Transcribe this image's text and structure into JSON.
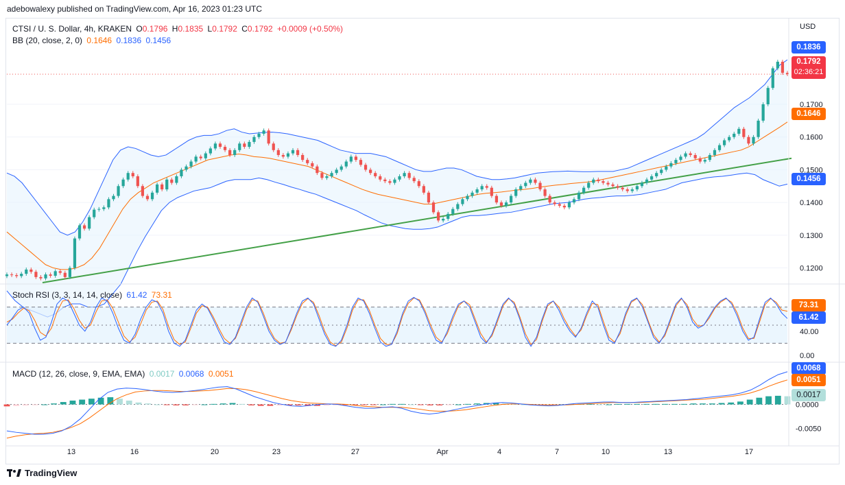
{
  "header": {
    "publish_line": "adebowalexy published on TradingView.com, Apr 16, 2023 01:23 UTC"
  },
  "main_legend": {
    "symbol": "CTSI / U. S. Dollar, 4h, KRAKEN",
    "o_label": "O",
    "o": "0.1796",
    "h_label": "H",
    "h": "0.1835",
    "l_label": "L",
    "l": "0.1792",
    "c_label": "C",
    "c": "0.1792",
    "change": "+0.0009 (+0.50%)",
    "bb_label": "BB (20, close, 2, 0)",
    "bb_basis": "0.1646",
    "bb_upper": "0.1836",
    "bb_lower": "0.1456"
  },
  "stoch_legend": {
    "label": "Stoch RSI (3, 3, 14, 14, close)",
    "k": "61.42",
    "d": "73.31"
  },
  "macd_legend": {
    "label": "MACD (12, 26, close, 9, EMA, EMA)",
    "hist": "0.0017",
    "macd": "0.0068",
    "signal": "0.0051"
  },
  "price_axis": {
    "currency": "USD",
    "ticks": [
      "0.1700",
      "0.1600",
      "0.1500",
      "0.1400",
      "0.1300",
      "0.1200"
    ],
    "last_price": "0.1792",
    "countdown": "02:36:21",
    "bb_upper_tag": "0.1836",
    "bb_basis_tag": "0.1646",
    "bb_lower_tag": "0.1456"
  },
  "stoch_axis": {
    "ticks": [
      "40.00",
      "0.00"
    ],
    "d_tag": "73.31",
    "k_tag": "61.42"
  },
  "macd_axis": {
    "ticks": [
      "0.0000",
      "-0.0050"
    ],
    "macd_tag": "0.0068",
    "signal_tag": "0.0051",
    "hist_tag": "0.0017"
  },
  "time_axis": {
    "ticks": [
      "13",
      "16",
      "20",
      "23",
      "27",
      "Apr",
      "4",
      "7",
      "10",
      "13",
      "17"
    ]
  },
  "footer": {
    "brand": "TradingView"
  },
  "colors": {
    "up": "#26a69a",
    "down": "#ef5350",
    "bb_band": "#2962ff",
    "bb_basis": "#ff6d00",
    "trendline": "#43a047",
    "k_line": "#2962ff",
    "d_line": "#ff6d00"
  },
  "chart_data": {
    "type": "line",
    "title": "CTSI / U. S. Dollar, 4h, KRAKEN",
    "close": [
      0.118,
      0.1178,
      0.1175,
      0.1182,
      0.1195,
      0.1188,
      0.1172,
      0.1168,
      0.118,
      0.1176,
      0.119,
      0.1185,
      0.1172,
      0.12,
      0.129,
      0.133,
      0.132,
      0.1355,
      0.1378,
      0.138,
      0.1385,
      0.141,
      0.142,
      0.145,
      0.147,
      0.149,
      0.148,
      0.145,
      0.142,
      0.141,
      0.143,
      0.1455,
      0.144,
      0.147,
      0.146,
      0.148,
      0.15,
      0.151,
      0.1525,
      0.154,
      0.1535,
      0.155,
      0.1565,
      0.158,
      0.157,
      0.156,
      0.1545,
      0.156,
      0.158,
      0.157,
      0.1585,
      0.16,
      0.161,
      0.162,
      0.158,
      0.156,
      0.1545,
      0.154,
      0.155,
      0.156,
      0.1545,
      0.153,
      0.152,
      0.151,
      0.149,
      0.1475,
      0.148,
      0.149,
      0.15,
      0.151,
      0.1525,
      0.154,
      0.153,
      0.1515,
      0.15,
      0.149,
      0.148,
      0.147,
      0.1465,
      0.146,
      0.147,
      0.148,
      0.149,
      0.1475,
      0.1465,
      0.145,
      0.143,
      0.14,
      0.137,
      0.1345,
      0.135,
      0.1365,
      0.138,
      0.1395,
      0.141,
      0.142,
      0.143,
      0.144,
      0.145,
      0.1445,
      0.142,
      0.14,
      0.139,
      0.14,
      0.142,
      0.144,
      0.145,
      0.146,
      0.147,
      0.146,
      0.144,
      0.142,
      0.14,
      0.1395,
      0.139,
      0.1385,
      0.14,
      0.141,
      0.143,
      0.1445,
      0.146,
      0.147,
      0.1465,
      0.146,
      0.1455,
      0.145,
      0.1445,
      0.144,
      0.1435,
      0.144,
      0.145,
      0.146,
      0.147,
      0.148,
      0.149,
      0.15,
      0.151,
      0.152,
      0.153,
      0.154,
      0.155,
      0.1545,
      0.1535,
      0.1525,
      0.153,
      0.1545,
      0.156,
      0.1575,
      0.159,
      0.16,
      0.161,
      0.1625,
      0.16,
      0.158,
      0.16,
      0.165,
      0.17,
      0.175,
      0.181,
      0.183,
      0.1796,
      0.1792
    ],
    "bb_upper": [
      0.149,
      0.148,
      0.146,
      0.143,
      0.14,
      0.137,
      0.134,
      0.131,
      0.13,
      0.131,
      0.134,
      0.138,
      0.143,
      0.148,
      0.153,
      0.156,
      0.157,
      0.1565,
      0.1555,
      0.1545,
      0.154,
      0.1545,
      0.156,
      0.1575,
      0.159,
      0.16,
      0.1605,
      0.1605,
      0.161,
      0.162,
      0.1625,
      0.1615,
      0.161,
      0.1612,
      0.1614,
      0.1615,
      0.1613,
      0.161,
      0.1605,
      0.16,
      0.1595,
      0.159,
      0.158,
      0.157,
      0.156,
      0.1555,
      0.155,
      0.155,
      0.155,
      0.1545,
      0.154,
      0.153,
      0.152,
      0.151,
      0.15,
      0.1495,
      0.1495,
      0.15,
      0.1505,
      0.1505,
      0.15,
      0.149,
      0.148,
      0.1475,
      0.147,
      0.147,
      0.1472,
      0.1475,
      0.148,
      0.1485,
      0.149,
      0.1492,
      0.1494,
      0.1495,
      0.1496,
      0.1495,
      0.1494,
      0.1494,
      0.1495,
      0.1495,
      0.1495,
      0.15,
      0.1505,
      0.1515,
      0.1525,
      0.1535,
      0.1545,
      0.1555,
      0.1565,
      0.1575,
      0.1585,
      0.1595,
      0.161,
      0.163,
      0.165,
      0.167,
      0.169,
      0.1705,
      0.172,
      0.174,
      0.176,
      0.179,
      0.182,
      0.1836
    ],
    "bb_basis": [
      0.131,
      0.129,
      0.127,
      0.125,
      0.123,
      0.121,
      0.12,
      0.1195,
      0.1195,
      0.12,
      0.121,
      0.123,
      0.126,
      0.13,
      0.134,
      0.138,
      0.141,
      0.143,
      0.1445,
      0.146,
      0.147,
      0.148,
      0.149,
      0.15,
      0.151,
      0.152,
      0.153,
      0.1535,
      0.154,
      0.1545,
      0.1548,
      0.1545,
      0.154,
      0.1538,
      0.1535,
      0.153,
      0.1525,
      0.152,
      0.1515,
      0.151,
      0.15,
      0.149,
      0.148,
      0.147,
      0.146,
      0.145,
      0.144,
      0.1432,
      0.1425,
      0.142,
      0.1415,
      0.141,
      0.1405,
      0.14,
      0.1395,
      0.1395,
      0.14,
      0.1405,
      0.141,
      0.1415,
      0.142,
      0.1425,
      0.1428,
      0.143,
      0.1432,
      0.1435,
      0.1438,
      0.144,
      0.1443,
      0.1447,
      0.145,
      0.1453,
      0.1455,
      0.1458,
      0.146,
      0.1462,
      0.1465,
      0.147,
      0.1475,
      0.148,
      0.1485,
      0.149,
      0.1495,
      0.15,
      0.1505,
      0.151,
      0.1515,
      0.152,
      0.1525,
      0.153,
      0.1535,
      0.154,
      0.1545,
      0.155,
      0.1555,
      0.156,
      0.157,
      0.1585,
      0.16,
      0.1615,
      0.163,
      0.1646
    ],
    "bb_lower": [
      0.113,
      0.11,
      0.108,
      0.107,
      0.106,
      0.105,
      0.106,
      0.108,
      0.109,
      0.109,
      0.108,
      0.108,
      0.109,
      0.112,
      0.115,
      0.12,
      0.125,
      0.1295,
      0.1335,
      0.1375,
      0.14,
      0.1415,
      0.1425,
      0.1435,
      0.144,
      0.1445,
      0.1455,
      0.1465,
      0.147,
      0.147,
      0.147,
      0.1475,
      0.147,
      0.1462,
      0.1455,
      0.1447,
      0.144,
      0.1432,
      0.1425,
      0.1415,
      0.1405,
      0.1395,
      0.1385,
      0.1375,
      0.1362,
      0.135,
      0.1338,
      0.133,
      0.1325,
      0.132,
      0.1318,
      0.1318,
      0.132,
      0.1325,
      0.1335,
      0.1345,
      0.1355,
      0.136,
      0.136,
      0.1362,
      0.1365,
      0.1368,
      0.137,
      0.1375,
      0.138,
      0.1385,
      0.139,
      0.1395,
      0.1398,
      0.14,
      0.1405,
      0.141,
      0.1413,
      0.1415,
      0.1418,
      0.142,
      0.142,
      0.1422,
      0.1425,
      0.143,
      0.1435,
      0.144,
      0.145,
      0.146,
      0.1465,
      0.147,
      0.1475,
      0.1478,
      0.148,
      0.1483,
      0.1487,
      0.149,
      0.1485,
      0.147,
      0.146,
      0.145,
      0.1456
    ],
    "trendline": {
      "from": 0.1155,
      "to": 0.1535
    },
    "stoch_k": [
      50,
      62,
      75,
      80,
      70,
      45,
      25,
      30,
      55,
      85,
      95,
      90,
      70,
      50,
      40,
      55,
      80,
      95,
      90,
      70,
      45,
      25,
      20,
      35,
      60,
      80,
      92,
      88,
      70,
      40,
      20,
      15,
      25,
      50,
      75,
      85,
      78,
      60,
      40,
      22,
      18,
      30,
      55,
      80,
      95,
      88,
      65,
      40,
      25,
      18,
      22,
      45,
      70,
      90,
      95,
      85,
      60,
      35,
      18,
      15,
      25,
      50,
      80,
      95,
      90,
      70,
      45,
      22,
      15,
      18,
      40,
      70,
      90,
      96,
      90,
      70,
      45,
      25,
      20,
      40,
      65,
      85,
      90,
      80,
      55,
      30,
      20,
      35,
      60,
      85,
      95,
      85,
      60,
      30,
      15,
      30,
      60,
      85,
      90,
      75,
      55,
      40,
      30,
      45,
      70,
      90,
      80,
      50,
      25,
      20,
      40,
      70,
      90,
      95,
      80,
      55,
      30,
      20,
      35,
      60,
      85,
      95,
      80,
      55,
      45,
      50,
      65,
      80,
      90,
      95,
      85,
      65,
      40,
      25,
      30,
      60,
      88,
      95,
      85,
      70,
      61
    ],
    "stoch_d": [
      55,
      60,
      70,
      78,
      74,
      58,
      38,
      32,
      45,
      72,
      90,
      92,
      78,
      58,
      45,
      50,
      72,
      90,
      92,
      78,
      55,
      32,
      22,
      30,
      52,
      75,
      88,
      90,
      76,
      48,
      26,
      18,
      22,
      45,
      70,
      82,
      80,
      64,
      45,
      28,
      20,
      28,
      50,
      76,
      92,
      90,
      70,
      45,
      28,
      20,
      22,
      42,
      66,
      86,
      94,
      88,
      66,
      40,
      22,
      16,
      22,
      45,
      75,
      92,
      92,
      75,
      50,
      28,
      18,
      18,
      36,
      66,
      86,
      95,
      92,
      74,
      50,
      30,
      22,
      36,
      60,
      82,
      90,
      84,
      60,
      36,
      22,
      32,
      56,
      82,
      94,
      88,
      64,
      36,
      18,
      26,
      56,
      82,
      90,
      80,
      60,
      44,
      32,
      42,
      66,
      86,
      84,
      56,
      30,
      22,
      36,
      66,
      88,
      94,
      84,
      58,
      34,
      22,
      32,
      56,
      82,
      94,
      84,
      60,
      48,
      50,
      62,
      78,
      88,
      94,
      88,
      70,
      45,
      28,
      28,
      55,
      84,
      94,
      88,
      75,
      73
    ],
    "macd": [
      -0.0055,
      -0.0058,
      -0.006,
      -0.0062,
      -0.0062,
      -0.006,
      -0.0055,
      -0.0045,
      -0.003,
      -0.001,
      0.001,
      0.0025,
      0.0032,
      0.0034,
      0.0033,
      0.0031,
      0.0028,
      0.0026,
      0.0025,
      0.0026,
      0.0028,
      0.003,
      0.0033,
      0.0036,
      0.0037,
      0.0032,
      0.0024,
      0.0016,
      0.001,
      0.0004,
      0.0,
      -0.0003,
      -0.0004,
      -0.0002,
      0.0,
      0.0001,
      0.0,
      -0.0003,
      -0.0006,
      -0.0008,
      -0.0008,
      -0.0006,
      -0.0005,
      -0.0008,
      -0.0014,
      -0.0018,
      -0.002,
      -0.0018,
      -0.0014,
      -0.001,
      -0.0006,
      -0.0003,
      0.0,
      0.0003,
      0.0004,
      0.0003,
      0.0001,
      -0.0001,
      -0.0002,
      -0.0003,
      -0.0002,
      0.0,
      0.0002,
      0.0003,
      0.0004,
      0.0005,
      0.0005,
      0.0004,
      0.0004,
      0.0005,
      0.0006,
      0.0007,
      0.0008,
      0.0009,
      0.001,
      0.0012,
      0.0014,
      0.0016,
      0.0018,
      0.002,
      0.0024,
      0.003,
      0.004,
      0.0052,
      0.0062,
      0.0068
    ],
    "signal": [
      -0.007,
      -0.0066,
      -0.0063,
      -0.0061,
      -0.006,
      -0.0058,
      -0.0054,
      -0.0048,
      -0.004,
      -0.0028,
      -0.0014,
      0.0,
      0.0012,
      0.002,
      0.0026,
      0.0028,
      0.0029,
      0.0029,
      0.0028,
      0.0027,
      0.0027,
      0.0028,
      0.0029,
      0.0031,
      0.0033,
      0.0033,
      0.0031,
      0.0027,
      0.0022,
      0.0017,
      0.0012,
      0.0008,
      0.0005,
      0.0003,
      0.0002,
      0.0001,
      0.0001,
      0.0,
      -0.0002,
      -0.0004,
      -0.0005,
      -0.0006,
      -0.0006,
      -0.0006,
      -0.0008,
      -0.001,
      -0.0013,
      -0.0014,
      -0.0014,
      -0.0013,
      -0.0011,
      -0.0008,
      -0.0005,
      -0.0002,
      0.0,
      0.0001,
      0.0001,
      0.0,
      -0.0001,
      -0.0001,
      -0.0001,
      -0.0001,
      0.0,
      0.0001,
      0.0002,
      0.0003,
      0.0004,
      0.0004,
      0.0004,
      0.0004,
      0.0005,
      0.0006,
      0.0007,
      0.0008,
      0.0009,
      0.001,
      0.0011,
      0.0013,
      0.0015,
      0.0017,
      0.002,
      0.0024,
      0.003,
      0.0038,
      0.0045,
      0.0051
    ],
    "hist": [
      -0.0004,
      -0.0003,
      -0.0002,
      -0.0001,
      0.0,
      0.0002,
      0.0005,
      0.0008,
      0.001,
      0.0012,
      0.0014,
      0.0015,
      0.0012,
      0.0008,
      0.0004,
      0.0002,
      0.0,
      -0.0001,
      -0.0002,
      -0.0002,
      -0.0001,
      0.0,
      0.0001,
      0.0002,
      0.0003,
      0.0001,
      -0.0002,
      -0.0003,
      -0.0003,
      -0.0002,
      -0.0002,
      -0.0002,
      -0.0003,
      -0.0003,
      -0.0002,
      -0.0001,
      -0.0001,
      -0.0001,
      -0.0001,
      -0.0001,
      0.0,
      0.0001,
      0.0001,
      0.0,
      -0.0001,
      -0.0002,
      -0.0002,
      -0.0001,
      0.0,
      0.0001,
      0.0002,
      0.0003,
      0.0003,
      0.0002,
      0.0001,
      0.0,
      -0.0001,
      -0.0001,
      -0.0001,
      0.0,
      0.0001,
      0.0001,
      0.0001,
      0.0,
      0.0,
      0.0001,
      0.0001,
      0.0001,
      0.0001,
      0.0001,
      0.0001,
      0.0001,
      0.0001,
      0.0002,
      0.0002,
      0.0002,
      0.0003,
      0.0004,
      0.0006,
      0.001,
      0.0014,
      0.0017,
      0.0018,
      0.0017
    ]
  }
}
